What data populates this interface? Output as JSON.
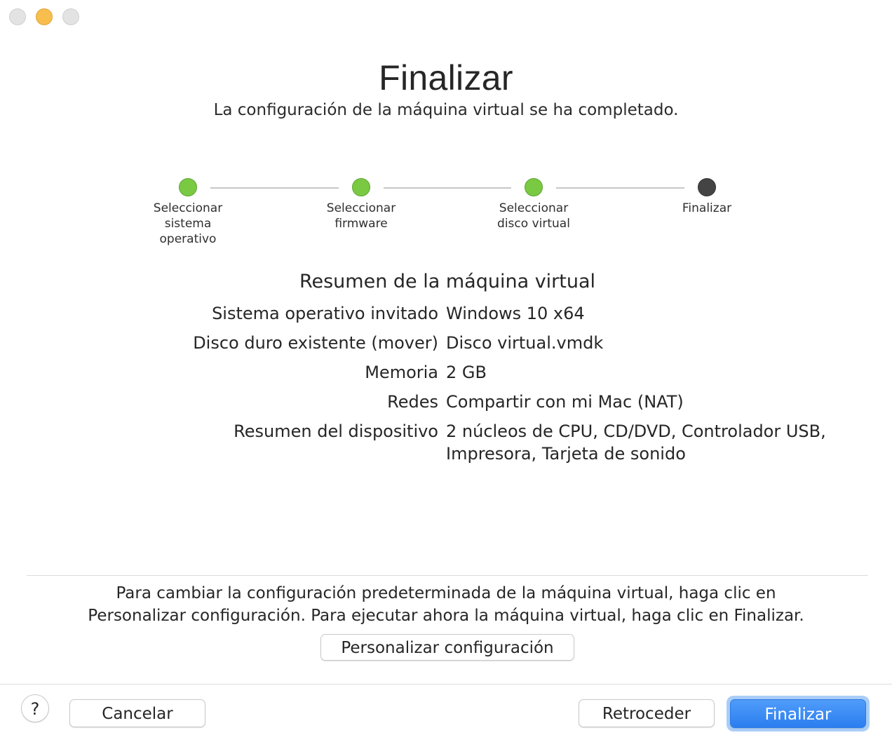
{
  "window": {
    "title": "Finalizar",
    "subtitle": "La configuración de la máquina virtual se ha completado."
  },
  "colors": {
    "step_done": "#7ac943",
    "step_current": "#444444",
    "primary_button": "#2c7ef0"
  },
  "steps": [
    {
      "label": "Seleccionar\nsistema\noperativo",
      "state": "done"
    },
    {
      "label": "Seleccionar\nfirmware",
      "state": "done"
    },
    {
      "label": "Seleccionar\ndisco virtual",
      "state": "done"
    },
    {
      "label": "Finalizar",
      "state": "current"
    }
  ],
  "summary": {
    "title": "Resumen de la máquina virtual",
    "rows": [
      {
        "label": "Sistema operativo invitado",
        "value": "Windows 10 x64"
      },
      {
        "label": "Disco duro existente (mover)",
        "value": "Disco virtual.vmdk"
      },
      {
        "label": "Memoria",
        "value": "2 GB"
      },
      {
        "label": "Redes",
        "value": "Compartir con mi Mac (NAT)"
      },
      {
        "label": "Resumen del dispositivo",
        "value": "2 núcleos de CPU, CD/DVD, Controlador USB,\nImpresora, Tarjeta de sonido"
      }
    ]
  },
  "info_text": "Para cambiar la configuración predeterminada de la máquina virtual, haga clic en\nPersonalizar configuración. Para ejecutar ahora la máquina virtual, haga clic en Finalizar.",
  "buttons": {
    "customize": "Personalizar configuración",
    "help": "?",
    "cancel": "Cancelar",
    "back": "Retroceder",
    "finish": "Finalizar"
  }
}
